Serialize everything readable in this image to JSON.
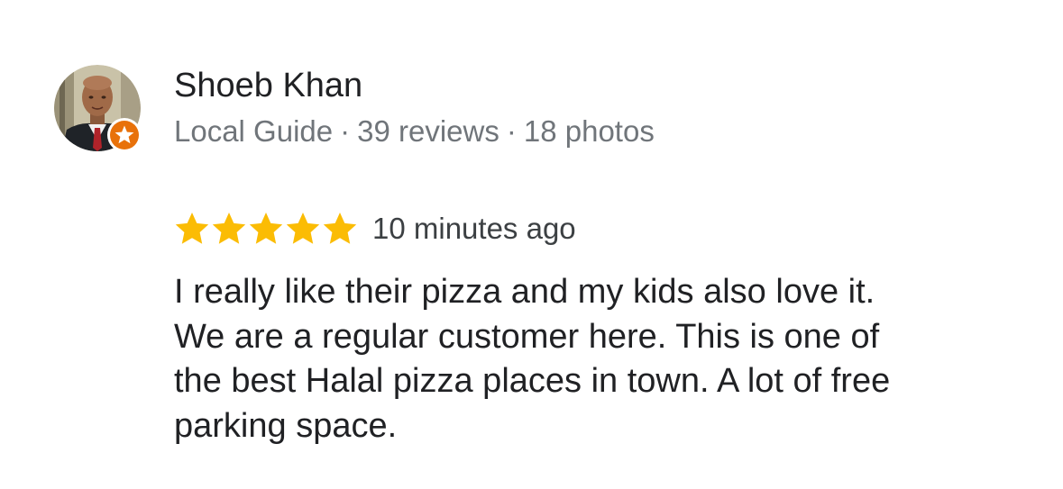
{
  "review": {
    "author": {
      "name": "Shoeb Khan",
      "badge": "Local Guide",
      "reviews_count": "39 reviews",
      "photos_count": "18 photos",
      "separator": "·",
      "avatar_icon": "person-avatar",
      "badge_icon": "local-guide-star-badge"
    },
    "rating": {
      "stars": 5,
      "max_stars": 5,
      "star_color": "#fbbc04",
      "time": "10 minutes ago"
    },
    "lines": [
      "I really like their pizza and my kids also love it.",
      "We are a regular customer here. This is one of",
      "the best Halal pizza places in town. A lot of free",
      "parking space."
    ]
  },
  "colors": {
    "name": "#202124",
    "meta": "#70757a",
    "badge": "#e8710a",
    "body_text": "#202124"
  }
}
